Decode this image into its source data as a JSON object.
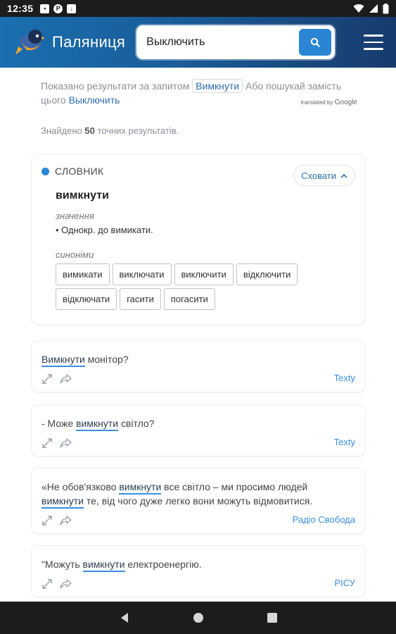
{
  "status_bar": {
    "time": "12:35"
  },
  "header": {
    "brand": "Паляниця",
    "search_value": "Выключить"
  },
  "notice": {
    "prefix": "Показано результати за запитом",
    "query": "Вимкнути",
    "middle": "Або пошукай замість цього",
    "original": "Выключить",
    "translated_by": "translated by",
    "google": "Google"
  },
  "results": {
    "prefix": "Знайдено",
    "count": "50",
    "suffix": "точних результатів."
  },
  "dictionary": {
    "section_label": "СЛОВНИК",
    "hide_label": "Сховати",
    "word": "вимкнути",
    "meaning_label": "значення",
    "meaning": "Однокр. до вимикати.",
    "synonyms_label": "синоніми",
    "synonyms": [
      "вимикати",
      "виключати",
      "виключити",
      "відключити",
      "відключати",
      "гасити",
      "погасити"
    ]
  },
  "examples": [
    {
      "before": "",
      "highlight": "Вимкнути",
      "after": " монітор?",
      "source": "Texty"
    },
    {
      "before": "- Може ",
      "highlight": "вимкнути",
      "after": " світло?",
      "source": "Texty"
    },
    {
      "line1_before": "«Не обов'язково ",
      "line1_highlight": "вимкнути",
      "line1_after": " все світло – ми просимо людей",
      "line2_highlight": "вимкнути",
      "line2_after": " те, від чого дуже легко вони можуть відмовитися.",
      "source": "Радіо Свобода"
    },
    {
      "before": "\"Можуть ",
      "highlight": "вимкнути",
      "after": " електроенергію.",
      "source": "РІСУ"
    }
  ]
}
